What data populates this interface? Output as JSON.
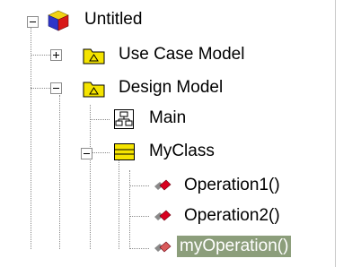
{
  "tree": {
    "root": {
      "label": "Untitled",
      "expanded": true,
      "children": [
        {
          "label": "Use Case Model",
          "expanded": false
        },
        {
          "label": "Design Model",
          "expanded": true,
          "children": [
            {
              "label": "Main"
            },
            {
              "label": "MyClass",
              "expanded": true,
              "children": [
                {
                  "label": "Operation1()"
                },
                {
                  "label": "Operation2()"
                },
                {
                  "label": "myOperation()",
                  "selected": true
                }
              ]
            }
          ]
        }
      ]
    }
  },
  "colors": {
    "selection_background": "#8c9e7b",
    "selection_text": "#ffffff",
    "folder_yellow": "#f5e400",
    "operation_red": "#d8001f",
    "connector_gray": "#8a8a8a"
  }
}
